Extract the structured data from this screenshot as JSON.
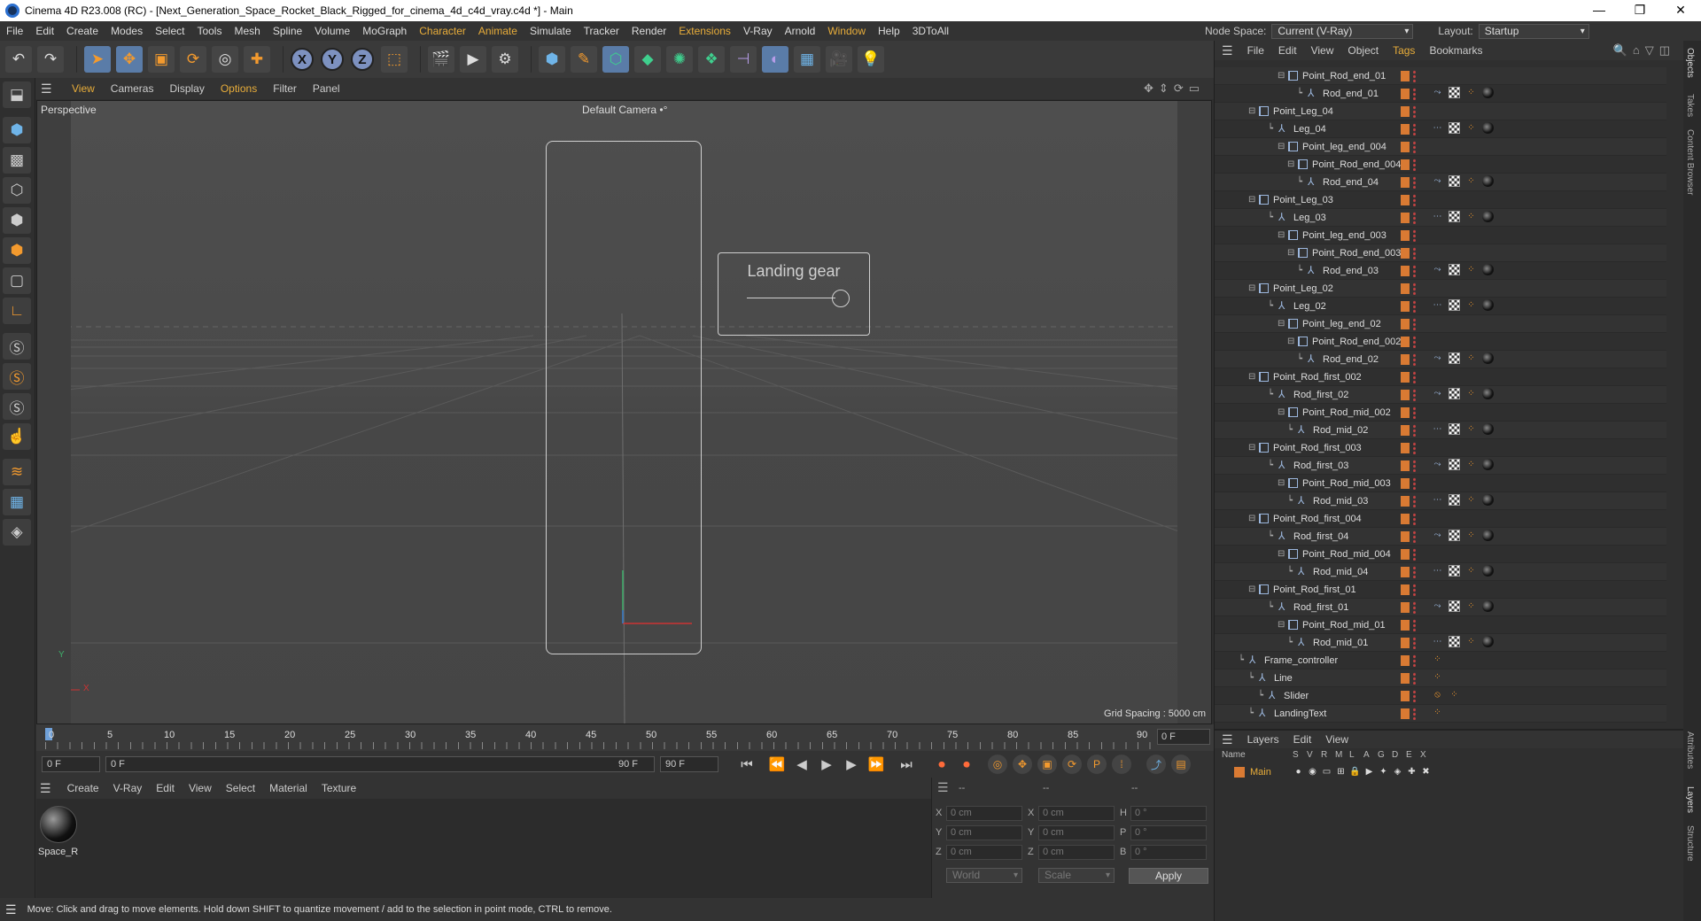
{
  "window": {
    "title": "Cinema 4D R23.008 (RC) - [Next_Generation_Space_Rocket_Black_Rigged_for_cinema_4d_c4d_vray.c4d *] - Main",
    "min": "—",
    "max": "❐",
    "close": "✕"
  },
  "menubar": {
    "items": [
      "File",
      "Edit",
      "Create",
      "Modes",
      "Select",
      "Tools",
      "Mesh",
      "Spline",
      "Volume",
      "MoGraph",
      "Character",
      "Animate",
      "Simulate",
      "Tracker",
      "Render",
      "Extensions",
      "V-Ray",
      "Arnold",
      "Window",
      "Help",
      "3DToAll"
    ],
    "node_space_label": "Node Space:",
    "node_space_value": "Current (V-Ray)",
    "layout_label": "Layout:",
    "layout_value": "Startup"
  },
  "viewport_menu": {
    "items": [
      "View",
      "Cameras",
      "Display",
      "Options",
      "Filter",
      "Panel"
    ]
  },
  "viewport": {
    "view_name": "Perspective",
    "camera": "Default Camera",
    "camera_icon": "•°",
    "grid_spacing": "Grid Spacing : 5000 cm",
    "axis_y": "Y",
    "axis_x": "X",
    "overlay_title": "Landing gear",
    "slider_value": 1.0
  },
  "timeline": {
    "labels": [
      "0",
      "5",
      "10",
      "15",
      "20",
      "25",
      "30",
      "35",
      "40",
      "45",
      "50",
      "55",
      "60",
      "65",
      "70",
      "75",
      "80",
      "85",
      "90"
    ],
    "current": "0 F"
  },
  "transport": {
    "start": "0 F",
    "range_start": "0 F",
    "range_end": "90 F",
    "end": "90 F"
  },
  "material_menu": {
    "items": [
      "Create",
      "V-Ray",
      "Edit",
      "View",
      "Select",
      "Material",
      "Texture"
    ]
  },
  "material": {
    "name": "Space_R"
  },
  "coords": {
    "header1": "--",
    "header2": "--",
    "header3": "--",
    "rows": [
      {
        "a": "X",
        "av": "0 cm",
        "b": "X",
        "bv": "0 cm",
        "c": "H",
        "cv": "0 °"
      },
      {
        "a": "Y",
        "av": "0 cm",
        "b": "Y",
        "bv": "0 cm",
        "c": "P",
        "cv": "0 °"
      },
      {
        "a": "Z",
        "av": "0 cm",
        "b": "Z",
        "bv": "0 cm",
        "c": "B",
        "cv": "0 °"
      }
    ],
    "mode": "World",
    "scale": "Scale",
    "apply": "Apply"
  },
  "status": "Move: Click and drag to move elements. Hold down SHIFT to quantize movement / add to the selection in point mode, CTRL to remove.",
  "objects_menu": {
    "items": [
      "File",
      "Edit",
      "View",
      "Object",
      "Tags",
      "Bookmarks"
    ]
  },
  "objects": [
    {
      "name": "Point_Rod_end_01",
      "indent": 5,
      "type": "null",
      "tags": ""
    },
    {
      "name": "Rod_end_01",
      "indent": 7,
      "type": "bone",
      "tags": "full"
    },
    {
      "name": "Point_Leg_04",
      "indent": 2,
      "type": "null",
      "tags": ""
    },
    {
      "name": "Leg_04",
      "indent": 4,
      "type": "bone",
      "tags": "dots"
    },
    {
      "name": "Point_leg_end_004",
      "indent": 5,
      "type": "null",
      "tags": ""
    },
    {
      "name": "Point_Rod_end_004",
      "indent": 6,
      "type": "null",
      "tags": ""
    },
    {
      "name": "Rod_end_04",
      "indent": 7,
      "type": "bone",
      "tags": "full"
    },
    {
      "name": "Point_Leg_03",
      "indent": 2,
      "type": "null",
      "tags": ""
    },
    {
      "name": "Leg_03",
      "indent": 4,
      "type": "bone",
      "tags": "dots"
    },
    {
      "name": "Point_leg_end_003",
      "indent": 5,
      "type": "null",
      "tags": ""
    },
    {
      "name": "Point_Rod_end_003",
      "indent": 6,
      "type": "null",
      "tags": ""
    },
    {
      "name": "Rod_end_03",
      "indent": 7,
      "type": "bone",
      "tags": "full"
    },
    {
      "name": "Point_Leg_02",
      "indent": 2,
      "type": "null",
      "tags": ""
    },
    {
      "name": "Leg_02",
      "indent": 4,
      "type": "bone",
      "tags": "dots"
    },
    {
      "name": "Point_leg_end_02",
      "indent": 5,
      "type": "null",
      "tags": ""
    },
    {
      "name": "Point_Rod_end_002",
      "indent": 6,
      "type": "null",
      "tags": ""
    },
    {
      "name": "Rod_end_02",
      "indent": 7,
      "type": "bone",
      "tags": "full"
    },
    {
      "name": "Point_Rod_first_002",
      "indent": 2,
      "type": "null",
      "tags": ""
    },
    {
      "name": "Rod_first_02",
      "indent": 4,
      "type": "bone",
      "tags": "full"
    },
    {
      "name": "Point_Rod_mid_002",
      "indent": 5,
      "type": "null",
      "tags": ""
    },
    {
      "name": "Rod_mid_02",
      "indent": 6,
      "type": "bone",
      "tags": "dots"
    },
    {
      "name": "Point_Rod_first_003",
      "indent": 2,
      "type": "null",
      "tags": ""
    },
    {
      "name": "Rod_first_03",
      "indent": 4,
      "type": "bone",
      "tags": "full"
    },
    {
      "name": "Point_Rod_mid_003",
      "indent": 5,
      "type": "null",
      "tags": ""
    },
    {
      "name": "Rod_mid_03",
      "indent": 6,
      "type": "bone",
      "tags": "dots"
    },
    {
      "name": "Point_Rod_first_004",
      "indent": 2,
      "type": "null",
      "tags": ""
    },
    {
      "name": "Rod_first_04",
      "indent": 4,
      "type": "bone",
      "tags": "full"
    },
    {
      "name": "Point_Rod_mid_004",
      "indent": 5,
      "type": "null",
      "tags": ""
    },
    {
      "name": "Rod_mid_04",
      "indent": 6,
      "type": "bone",
      "tags": "dots"
    },
    {
      "name": "Point_Rod_first_01",
      "indent": 2,
      "type": "null",
      "tags": ""
    },
    {
      "name": "Rod_first_01",
      "indent": 4,
      "type": "bone",
      "tags": "full"
    },
    {
      "name": "Point_Rod_mid_01",
      "indent": 5,
      "type": "null",
      "tags": ""
    },
    {
      "name": "Rod_mid_01",
      "indent": 6,
      "type": "bone",
      "tags": "dots"
    },
    {
      "name": "Frame_controller",
      "indent": 1,
      "type": "bone",
      "tags": "dot"
    },
    {
      "name": "Line",
      "indent": 2,
      "type": "bone",
      "tags": "dot"
    },
    {
      "name": "Slider",
      "indent": 3,
      "type": "bone",
      "tags": "slider"
    },
    {
      "name": "LandingText",
      "indent": 2,
      "type": "bone",
      "tags": "dot"
    }
  ],
  "layers_menu": {
    "items": [
      "Layers",
      "Edit",
      "View"
    ]
  },
  "layers": {
    "columns": [
      "Name",
      "S",
      "V",
      "R",
      "M",
      "L",
      "A",
      "G",
      "D",
      "E",
      "X"
    ],
    "rows": [
      {
        "name": "Main"
      }
    ]
  },
  "side_tabs": [
    "Objects",
    "Takes",
    "Content Browser",
    "Attributes",
    "Layers",
    "Structure"
  ]
}
